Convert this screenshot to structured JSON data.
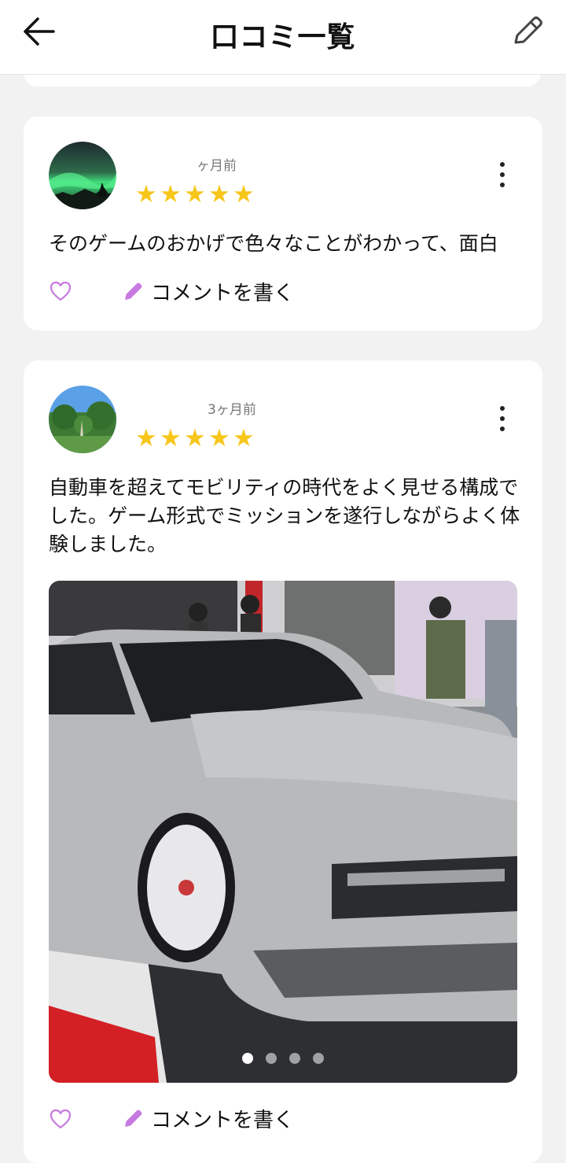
{
  "header": {
    "title": "口コミ一覧",
    "back_icon": "arrow-left-icon",
    "edit_icon": "pencil-icon"
  },
  "reviews": [
    {
      "time": "ヶ月前",
      "rating": 5,
      "text": "そのゲームのおかげで色々なことがわかって、面白",
      "comment_label": "コメントを書く",
      "avatar": "aurora-night-sky"
    },
    {
      "time": "3ヶ月前",
      "rating": 5,
      "text": "自動車を超えてモビリティの時代をよく見せる構成でした。ゲーム形式でミッションを遂行しながらよく体験しました。",
      "comment_label": "コメントを書く",
      "avatar": "garden-landscape",
      "photo_count": 4,
      "photo_active_index": 0
    }
  ],
  "colors": {
    "accent_purple": "#c77ae0",
    "star_yellow": "#f7c61b",
    "background": "#f2f2f2"
  }
}
